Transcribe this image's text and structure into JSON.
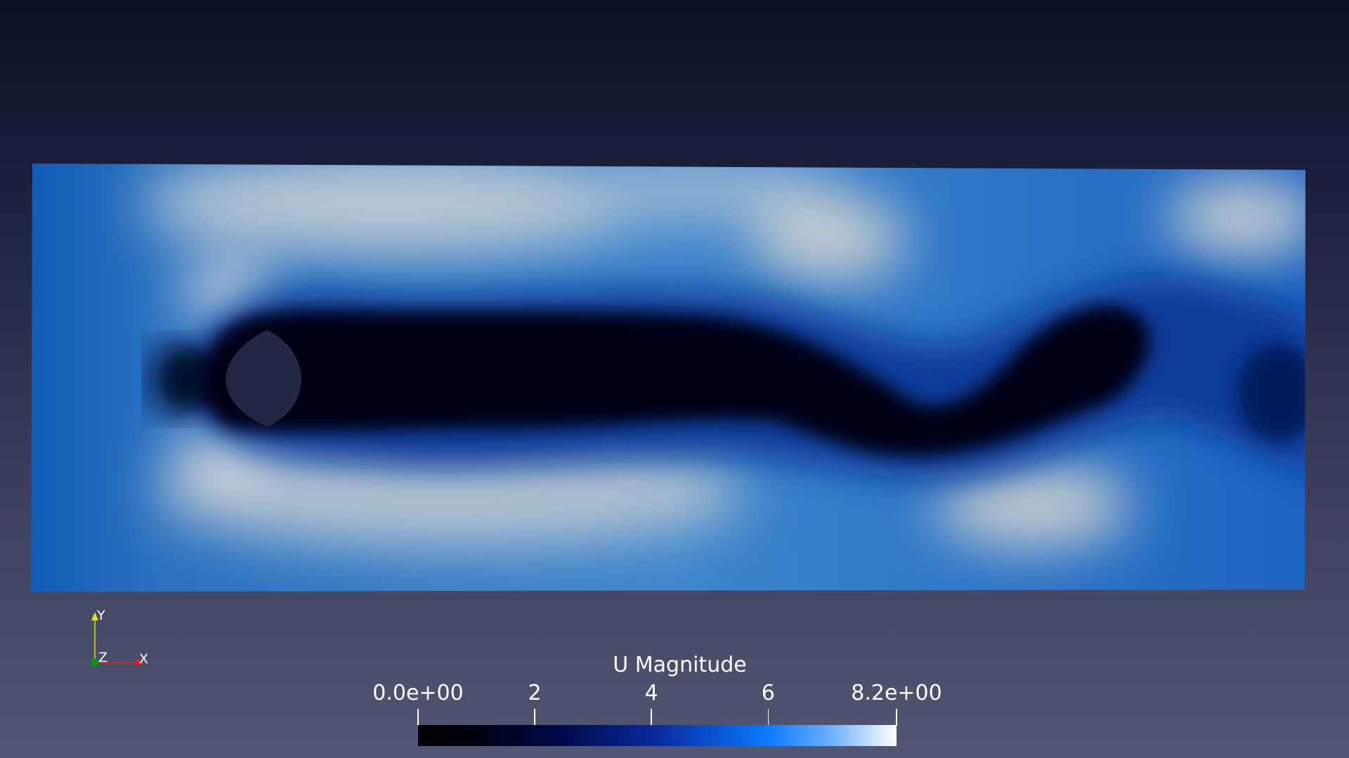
{
  "scene": {
    "colormap": {
      "name": "U Magnitude",
      "range_min": "0.0e+00",
      "range_max": "8.2e+00",
      "ticks": [
        "0.0e+00",
        "2",
        "4",
        "6",
        "8.2e+00"
      ],
      "tick_values": [
        0,
        2,
        4,
        6,
        8.2
      ],
      "colors": [
        "#000000",
        "#000a4a",
        "#0a2aa0",
        "#0a7aff",
        "#ffffff"
      ]
    },
    "orientation_axes": {
      "x_label": "X",
      "y_label": "Y",
      "z_label": "Z",
      "x_color": "#e02020",
      "y_color": "#e8e000",
      "z_color": "#109010"
    }
  }
}
